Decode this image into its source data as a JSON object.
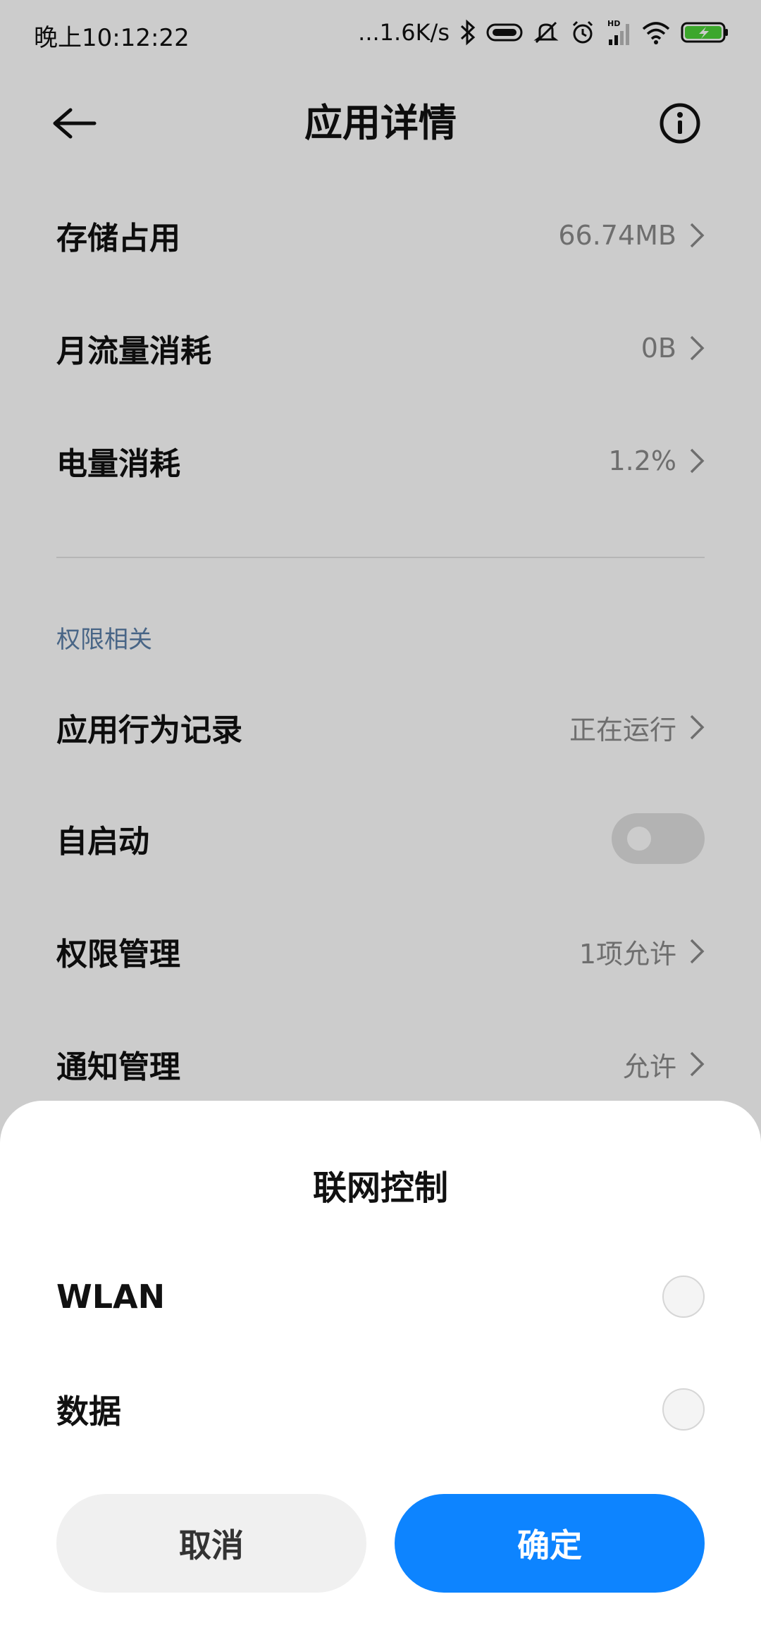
{
  "status_bar": {
    "time": "晚上10:12:22",
    "network_speed": "...1.6K/s",
    "icons": [
      "bluetooth-icon",
      "vibrate-icon",
      "mute-icon",
      "alarm-icon",
      "hd-signal-icon",
      "wifi-icon",
      "battery-charging-icon"
    ],
    "hd_label": "HD",
    "battery_color": "#4cd137"
  },
  "header": {
    "title": "应用详情",
    "back_icon": "back-arrow-icon",
    "info_icon": "info-icon"
  },
  "rows": [
    {
      "label": "存储占用",
      "value": "66.74MB"
    },
    {
      "label": "月流量消耗",
      "value": "0B"
    },
    {
      "label": "电量消耗",
      "value": "1.2%"
    }
  ],
  "permissions": {
    "section_title": "权限相关",
    "rows": [
      {
        "label": "应用行为记录",
        "value": "正在运行"
      },
      {
        "label": "自启动",
        "toggle_on": false
      },
      {
        "label": "权限管理",
        "value": "1项允许"
      },
      {
        "label": "通知管理",
        "value": "允许"
      }
    ]
  },
  "dialog": {
    "title": "联网控制",
    "options": [
      {
        "label": "WLAN",
        "checked": false
      },
      {
        "label": "数据",
        "checked": false
      }
    ],
    "cancel_label": "取消",
    "confirm_label": "确定",
    "accent_color": "#0d84ff"
  }
}
